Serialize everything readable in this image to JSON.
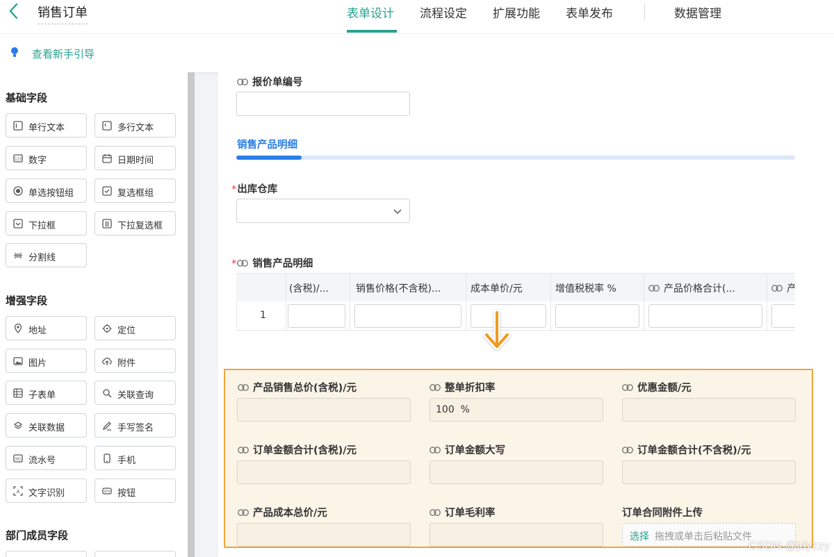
{
  "header": {
    "back_icon": "chevron-left-icon",
    "title": "销售订单",
    "tabs": [
      "表单设计",
      "流程设定",
      "扩展功能",
      "表单发布",
      "数据管理"
    ],
    "active_tab": "表单设计",
    "accent_color": "#2aa08e"
  },
  "guide": {
    "icon": "lightbulb-icon",
    "label": "查看新手引导"
  },
  "sidebar": {
    "groups": [
      {
        "title": "基础字段",
        "items": [
          {
            "label": "单行文本",
            "icon": "single-line-text-icon"
          },
          {
            "label": "多行文本",
            "icon": "multi-line-text-icon"
          },
          {
            "label": "数字",
            "icon": "number-icon"
          },
          {
            "label": "日期时间",
            "icon": "calendar-icon"
          },
          {
            "label": "单选按钮组",
            "icon": "radio-icon"
          },
          {
            "label": "复选框组",
            "icon": "checkbox-icon"
          },
          {
            "label": "下拉框",
            "icon": "dropdown-icon"
          },
          {
            "label": "下拉复选框",
            "icon": "dropdown-checkbox-icon"
          },
          {
            "label": "分割线",
            "icon": "divider-icon"
          }
        ]
      },
      {
        "title": "增强字段",
        "items": [
          {
            "label": "地址",
            "icon": "location-pin-icon"
          },
          {
            "label": "定位",
            "icon": "crosshair-icon"
          },
          {
            "label": "图片",
            "icon": "image-icon"
          },
          {
            "label": "附件",
            "icon": "cloud-upload-icon"
          },
          {
            "label": "子表单",
            "icon": "subform-icon"
          },
          {
            "label": "关联查询",
            "icon": "link-search-icon"
          },
          {
            "label": "关联数据",
            "icon": "link-data-icon"
          },
          {
            "label": "手写签名",
            "icon": "pen-icon"
          },
          {
            "label": "流水号",
            "icon": "serial-number-icon"
          },
          {
            "label": "手机",
            "icon": "phone-icon"
          },
          {
            "label": "文字识别",
            "icon": "ocr-icon"
          },
          {
            "label": "按钮",
            "icon": "button-icon"
          }
        ]
      },
      {
        "title": "部门成员字段",
        "items": []
      }
    ]
  },
  "form": {
    "quote_no_label": "报价单编号",
    "section_title": "销售产品明细",
    "warehouse_label": "出库仓库",
    "required_mark": "*",
    "subtable_label": "销售产品明细",
    "subtable": {
      "columns": [
        "(含税)/...",
        "销售价格(不含税)...",
        "成本单价/元",
        "增值税税率 %",
        "产品价格合计(...",
        "产"
      ],
      "rows": [
        {
          "index": "1"
        }
      ]
    },
    "calc_fields": [
      {
        "label": "产品销售总价(含税)/元",
        "value": "",
        "linked": true
      },
      {
        "label": "整单折扣率",
        "value": "100  %",
        "linked": true
      },
      {
        "label": "优惠金额/元",
        "value": "",
        "linked": true
      },
      {
        "label": "订单金额合计(含税)/元",
        "value": "",
        "linked": true
      },
      {
        "label": "订单金额大写",
        "value": "",
        "linked": true
      },
      {
        "label": "订单金额合计(不含税)/元",
        "value": "",
        "linked": true
      },
      {
        "label": "产品成本总价/元",
        "value": "",
        "linked": true
      },
      {
        "label": "订单毛利率",
        "value": "",
        "linked": true
      },
      {
        "label": "订单合同附件上传",
        "value": "",
        "linked": false
      }
    ],
    "upload": {
      "pick_label": "选择",
      "hint": "拖拽或单击后粘贴文件"
    },
    "highlight_color": "#f1a33a"
  },
  "watermark": "CSDN @jdyzzy"
}
